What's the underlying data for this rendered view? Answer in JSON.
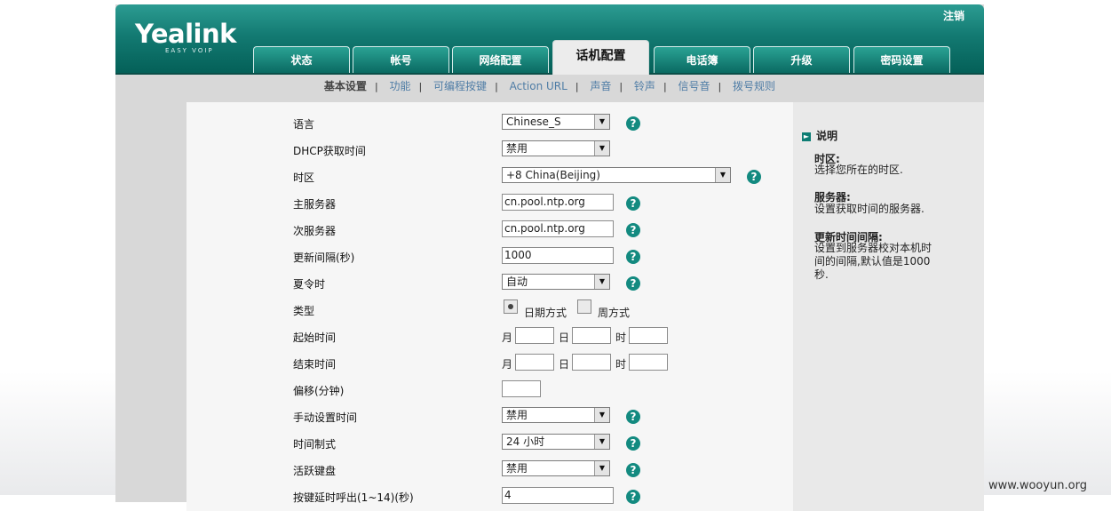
{
  "header": {
    "logo": "Yealink",
    "tagline": "EASY VOIP",
    "logout": "注销",
    "tabs": [
      "状态",
      "帐号",
      "网络配置",
      "话机配置",
      "电话簿",
      "升级",
      "密码设置"
    ],
    "active_tab": "话机配置"
  },
  "subnav": [
    "基本设置",
    "功能",
    "可编程按键",
    "Action URL",
    "声音",
    "铃声",
    "信号音",
    "拨号规则"
  ],
  "form": {
    "language": {
      "label": "语言",
      "value": "Chinese_S"
    },
    "dhcp_time": {
      "label": "DHCP获取时间",
      "value": "禁用"
    },
    "timezone": {
      "label": "时区",
      "value": "+8 China(Beijing)"
    },
    "primary_server": {
      "label": "主服务器",
      "value": "cn.pool.ntp.org"
    },
    "secondary_server": {
      "label": "次服务器",
      "value": "cn.pool.ntp.org"
    },
    "update_interval": {
      "label": "更新间隔(秒)",
      "value": "1000"
    },
    "dst": {
      "label": "夏令时",
      "value": "自动"
    },
    "type": {
      "label": "类型",
      "option_date": "日期方式",
      "option_week": "周方式"
    },
    "start_time": {
      "label": "起始时间"
    },
    "end_time": {
      "label": "结束时间"
    },
    "date_units": {
      "month": "月",
      "day": "日",
      "hour": "时"
    },
    "offset": {
      "label": "偏移(分钟)",
      "value": ""
    },
    "manual_time": {
      "label": "手动设置时间",
      "value": "禁用"
    },
    "time_format": {
      "label": "时间制式",
      "value": "24 小时"
    },
    "active_keypad": {
      "label": "活跃键盘",
      "value": "禁用"
    },
    "partial_row": {
      "label": "按键延时呼出(1~14)(秒)",
      "value": "4"
    }
  },
  "help_panel": {
    "title": "说明",
    "sections": [
      {
        "heading": "时区:",
        "text": "选择您所在的时区."
      },
      {
        "heading": "服务器:",
        "text": "设置获取时间的服务器."
      },
      {
        "heading": "更新时间间隔:",
        "text": "设置到服务器校对本机时间的间隔,默认值是1000秒."
      }
    ]
  },
  "watermark": "www.wooyun.org"
}
